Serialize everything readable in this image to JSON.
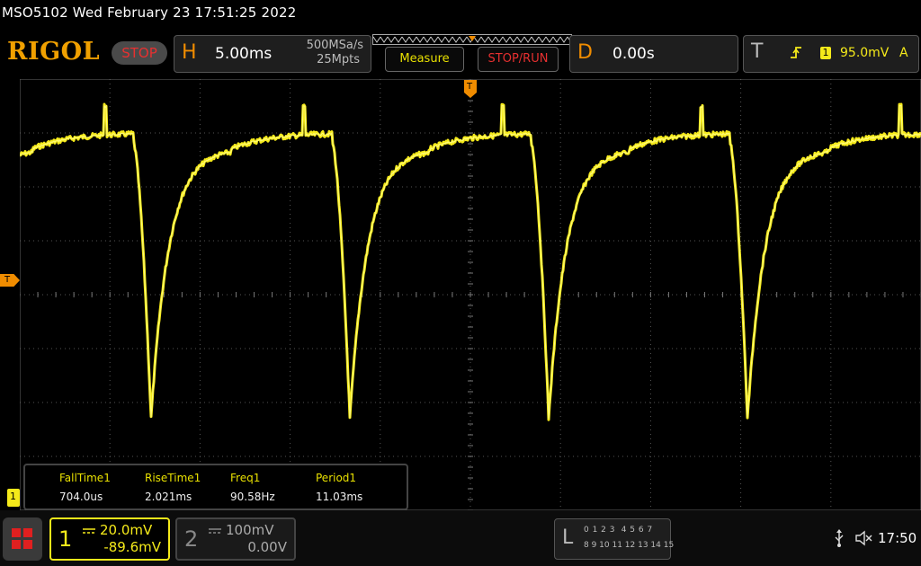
{
  "title": "MSO5102  Wed February 23 17:51:25 2022",
  "brand": "RIGOL",
  "run_state": "STOP",
  "horizontal": {
    "letter": "H",
    "timebase": "5.00ms",
    "sample_rate": "500MSa/s",
    "memory_depth": "25Mpts"
  },
  "buttons": {
    "measure": "Measure",
    "stop_run": "STOP/RUN"
  },
  "delay": {
    "letter": "D",
    "value": "0.00s"
  },
  "trigger": {
    "letter": "T",
    "source_badge": "1",
    "level": "95.0mV",
    "mode": "A"
  },
  "markers": {
    "trigger_level": "T",
    "channel1": "1",
    "trigger_pos": "T"
  },
  "measurements": [
    {
      "label": "FallTime1",
      "value": "704.0us"
    },
    {
      "label": "RiseTime1",
      "value": "2.021ms"
    },
    {
      "label": "Freq1",
      "value": "90.58Hz"
    },
    {
      "label": "Period1",
      "value": "11.03ms"
    }
  ],
  "channels": [
    {
      "num": "1",
      "scale": "20.0mV",
      "offset": "-89.6mV",
      "active": true
    },
    {
      "num": "2",
      "scale": "100mV",
      "offset": "0.00V",
      "active": false
    }
  ],
  "logic": {
    "letter": "L",
    "row1": "0 1 2 3  4 5 6 7",
    "row2": "8 9 10 11 12 13 14 15"
  },
  "clock": "17:50",
  "colors": {
    "trace": "#f5ea1a",
    "accent": "#f08c00",
    "stop": "#e83030"
  },
  "waveform": {
    "period_ms": 11.03,
    "fall_time_us": 704.0,
    "rise_time_ms": 2.021
  }
}
